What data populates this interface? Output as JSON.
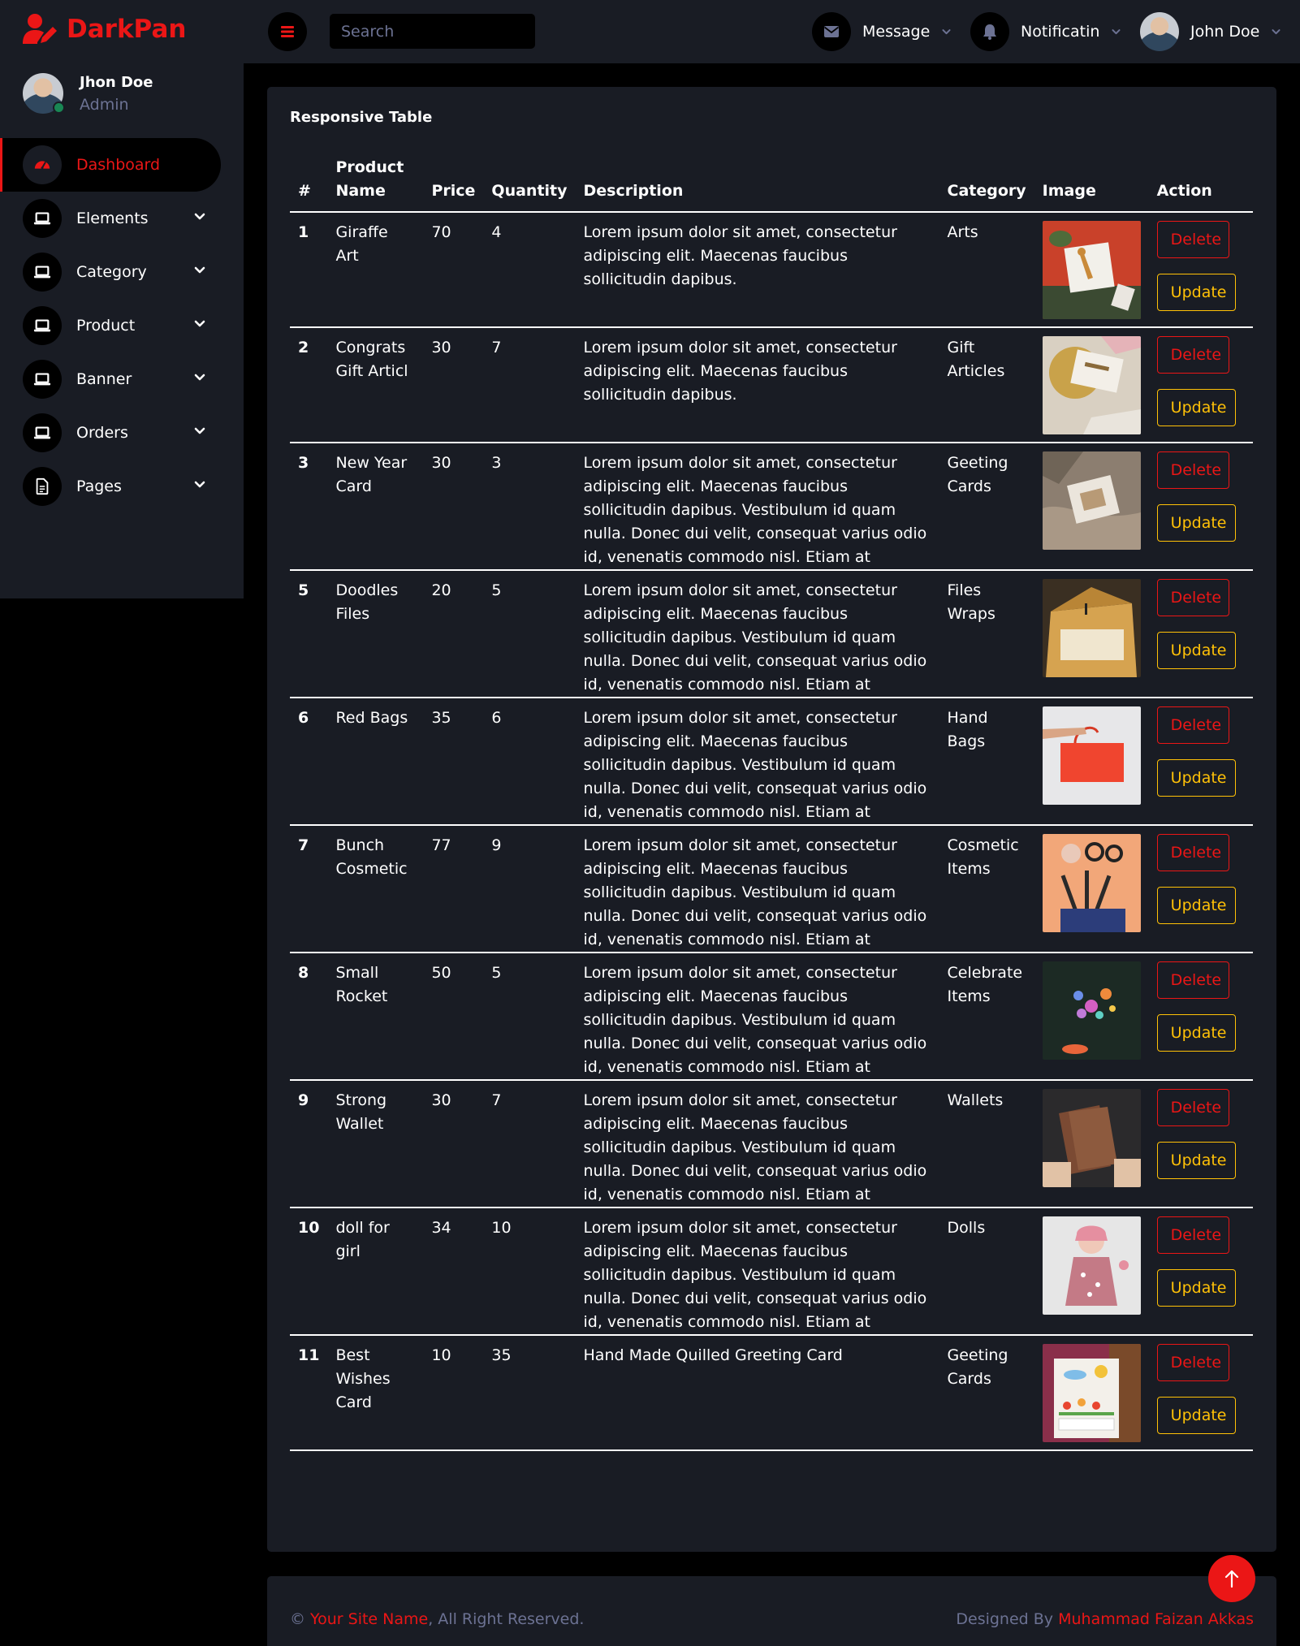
{
  "brand": {
    "name": "DarkPan",
    "accent": "#eb1616"
  },
  "profile": {
    "name": "Jhon Doe",
    "role": "Admin"
  },
  "nav": [
    {
      "label": "Dashboard",
      "icon": "dashboard-icon",
      "active": true
    },
    {
      "label": "Elements",
      "icon": "laptop-icon"
    },
    {
      "label": "Category",
      "icon": "laptop-icon"
    },
    {
      "label": "Product",
      "icon": "laptop-icon"
    },
    {
      "label": "Banner",
      "icon": "laptop-icon"
    },
    {
      "label": "Orders",
      "icon": "laptop-icon"
    },
    {
      "label": "Pages",
      "icon": "file-icon"
    }
  ],
  "topbar": {
    "search_placeholder": "Search",
    "message_label": "Message",
    "notification_label": "Notificatin",
    "user_name": "John Doe"
  },
  "table": {
    "title": "Responsive Table",
    "columns": [
      "#",
      "Product Name",
      "Price",
      "Quantity",
      "Description",
      "Category",
      "Image",
      "Action"
    ],
    "delete_label": "Delete",
    "update_label": "Update",
    "rows": [
      {
        "id": "1",
        "name": "Giraffe Art",
        "price": "70",
        "qty": "4",
        "desc": "Lorem ipsum dolor sit amet, consectetur adipiscing elit. Maecenas faucibus sollicitudin dapibus.",
        "category": "Arts"
      },
      {
        "id": "2",
        "name": "Congrats Gift Articl",
        "price": "30",
        "qty": "7",
        "desc": "Lorem ipsum dolor sit amet, consectetur adipiscing elit. Maecenas faucibus sollicitudin dapibus.",
        "category": "Gift Articles"
      },
      {
        "id": "3",
        "name": "New Year Card",
        "price": "30",
        "qty": "3",
        "desc": "Lorem ipsum dolor sit amet, consectetur adipiscing elit. Maecenas faucibus sollicitudin dapibus. Vestibulum id quam nulla. Donec dui velit, consequat varius odio id, venenatis commodo nisl. Etiam at",
        "category": "Geeting Cards"
      },
      {
        "id": "5",
        "name": "Doodles Files",
        "price": "20",
        "qty": "5",
        "desc": "Lorem ipsum dolor sit amet, consectetur adipiscing elit. Maecenas faucibus sollicitudin dapibus. Vestibulum id quam nulla. Donec dui velit, consequat varius odio id, venenatis commodo nisl. Etiam at",
        "category": "Files Wraps"
      },
      {
        "id": "6",
        "name": "Red Bags",
        "price": "35",
        "qty": "6",
        "desc": "Lorem ipsum dolor sit amet, consectetur adipiscing elit. Maecenas faucibus sollicitudin dapibus. Vestibulum id quam nulla. Donec dui velit, consequat varius odio id, venenatis commodo nisl. Etiam at",
        "category": "Hand Bags"
      },
      {
        "id": "7",
        "name": "Bunch Cosmetic",
        "price": "77",
        "qty": "9",
        "desc": "Lorem ipsum dolor sit amet, consectetur adipiscing elit. Maecenas faucibus sollicitudin dapibus. Vestibulum id quam nulla. Donec dui velit, consequat varius odio id, venenatis commodo nisl. Etiam at",
        "category": "Cosmetic Items"
      },
      {
        "id": "8",
        "name": "Small Rocket",
        "price": "50",
        "qty": "5",
        "desc": "Lorem ipsum dolor sit amet, consectetur adipiscing elit. Maecenas faucibus sollicitudin dapibus. Vestibulum id quam nulla. Donec dui velit, consequat varius odio id, venenatis commodo nisl. Etiam at",
        "category": "Celebrate Items"
      },
      {
        "id": "9",
        "name": "Strong Wallet",
        "price": "30",
        "qty": "7",
        "desc": "Lorem ipsum dolor sit amet, consectetur adipiscing elit. Maecenas faucibus sollicitudin dapibus. Vestibulum id quam nulla. Donec dui velit, consequat varius odio id, venenatis commodo nisl. Etiam at",
        "category": "Wallets"
      },
      {
        "id": "10",
        "name": "doll for girl",
        "price": "34",
        "qty": "10",
        "desc": "Lorem ipsum dolor sit amet, consectetur adipiscing elit. Maecenas faucibus sollicitudin dapibus. Vestibulum id quam nulla. Donec dui velit, consequat varius odio id, venenatis commodo nisl. Etiam at",
        "category": "Dolls"
      },
      {
        "id": "11",
        "name": "Best Wishes Card",
        "price": "10",
        "qty": "35",
        "desc": "Hand Made Quilled Greeting Card",
        "category": "Geeting Cards"
      }
    ]
  },
  "footer": {
    "copyright_symbol": "©",
    "site_name": "Your Site Name",
    "rights": ", All Right Reserved.",
    "designed_by": "Designed By",
    "designer": "Muhammad Faizan Akkas"
  }
}
